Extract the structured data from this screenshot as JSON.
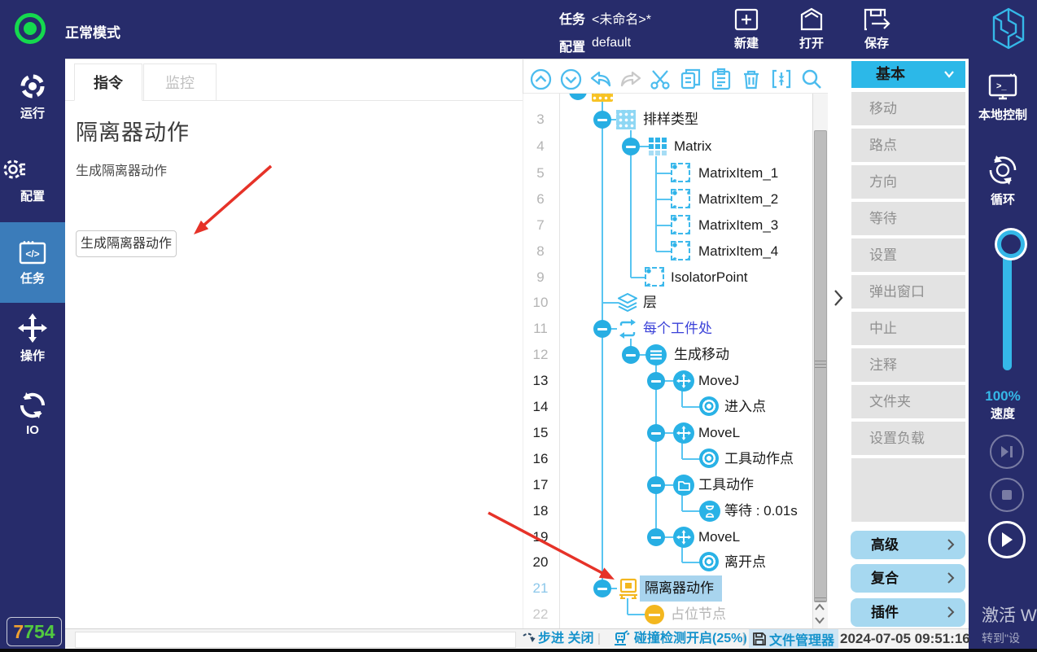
{
  "topbar": {
    "mode_label": "正常模式",
    "task_label": "任务",
    "task_value": "<未命名>*",
    "config_label": "配置",
    "config_value": "default",
    "actions": [
      {
        "label": "新建",
        "icon": "new-file-icon"
      },
      {
        "label": "打开",
        "icon": "open-file-icon"
      },
      {
        "label": "保存",
        "icon": "save-file-icon"
      }
    ]
  },
  "sidebar": {
    "items": [
      {
        "label": "运行",
        "icon": "run-icon",
        "active": false
      },
      {
        "label": "配置",
        "icon": "gear-icon",
        "active": false
      },
      {
        "label": "任务",
        "icon": "code-window-icon",
        "active": true
      },
      {
        "label": "操作",
        "icon": "jog-arrows-icon",
        "active": false
      },
      {
        "label": "IO",
        "icon": "io-cycle-icon",
        "active": false
      }
    ],
    "badge": {
      "digit_orange": "7",
      "digits_green": "754"
    }
  },
  "instruction_panel": {
    "tabs": [
      {
        "label": "指令",
        "active": true
      },
      {
        "label": "监控",
        "active": false
      }
    ],
    "title": "隔离器动作",
    "description": "生成隔离器动作",
    "button_label": "生成隔离器动作"
  },
  "tree_toolbar": {
    "icons": [
      "move-up-icon",
      "move-down-icon",
      "undo-icon",
      "redo-icon",
      "cut-icon",
      "copy-icon",
      "paste-icon",
      "delete-icon",
      "merge-icon",
      "search-icon"
    ]
  },
  "program_tree": {
    "rows": [
      {
        "num": "3",
        "label": "排样类型"
      },
      {
        "num": "4",
        "label": "Matrix"
      },
      {
        "num": "5",
        "label": "MatrixItem_1"
      },
      {
        "num": "6",
        "label": "MatrixItem_2"
      },
      {
        "num": "7",
        "label": "MatrixItem_3"
      },
      {
        "num": "8",
        "label": "MatrixItem_4"
      },
      {
        "num": "9",
        "label": "IsolatorPoint"
      },
      {
        "num": "10",
        "label": "层"
      },
      {
        "num": "11",
        "label": "每个工件处"
      },
      {
        "num": "12",
        "label": "生成移动"
      },
      {
        "num": "13",
        "label": "MoveJ"
      },
      {
        "num": "14",
        "label": "进入点"
      },
      {
        "num": "15",
        "label": "MoveL"
      },
      {
        "num": "16",
        "label": "工具动作点"
      },
      {
        "num": "17",
        "label": "工具动作"
      },
      {
        "num": "18",
        "label": "等待 : 0.01s"
      },
      {
        "num": "19",
        "label": "MoveL"
      },
      {
        "num": "20",
        "label": "离开点"
      },
      {
        "num": "21",
        "label": "隔离器动作",
        "selected": true
      },
      {
        "num": "22",
        "label": "占位节点"
      }
    ]
  },
  "palette": {
    "header": "基本",
    "items": [
      "移动",
      "路点",
      "方向",
      "等待",
      "设置",
      "弹出窗口",
      "中止",
      "注释",
      "文件夹",
      "设置负载"
    ],
    "groups": [
      "高级",
      "复合",
      "插件"
    ]
  },
  "right_toolbar": {
    "local_control": "本地控制",
    "loop": "循环",
    "speed_value": "100%",
    "speed_label": "速度",
    "playback_icons": [
      "skip-icon",
      "stop-icon",
      "play-icon"
    ]
  },
  "statusbar": {
    "step": "步进 关闭",
    "collision": "碰撞检测开启(25%)",
    "file_manager": "文件管理器",
    "timestamp": "2024-07-05 09:51:16"
  },
  "watermark": {
    "line1": "激活 W",
    "line2": "转到\"设"
  },
  "colors": {
    "accent_cyan": "#3ab6e8",
    "navy": "#272c6b",
    "selection_blue": "#a8d4ee",
    "highlight_yellow": "#f3b71f",
    "arrow_red": "#e63228",
    "status_blue": "#1693cc"
  }
}
